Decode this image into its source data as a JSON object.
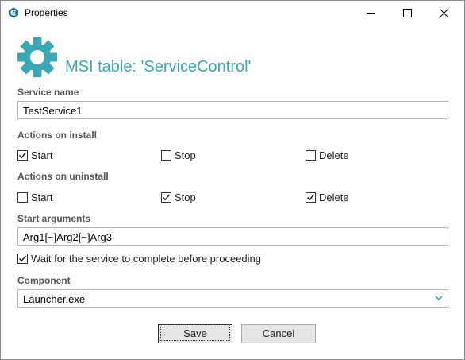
{
  "window": {
    "title": "Properties"
  },
  "header": {
    "heading": "MSI table: 'ServiceControl'"
  },
  "service_name": {
    "label": "Service name",
    "value": "TestService1"
  },
  "actions_on_install": {
    "label": "Actions on install",
    "options": [
      {
        "label": "Start",
        "checked": true
      },
      {
        "label": "Stop",
        "checked": false
      },
      {
        "label": "Delete",
        "checked": false
      }
    ]
  },
  "actions_on_uninstall": {
    "label": "Actions on uninstall",
    "options": [
      {
        "label": "Start",
        "checked": false
      },
      {
        "label": "Stop",
        "checked": true
      },
      {
        "label": "Delete",
        "checked": true
      }
    ]
  },
  "start_arguments": {
    "label": "Start arguments",
    "value": "Arg1[~]Arg2[~]Arg3"
  },
  "wait_option": {
    "label": "Wait for the service to complete before proceeding",
    "checked": true
  },
  "component": {
    "label": "Component",
    "value": "Launcher.exe"
  },
  "buttons": {
    "save": "Save",
    "cancel": "Cancel"
  },
  "colors": {
    "accent": "#3aa7b6",
    "label": "#555555",
    "border": "#b4b4b4"
  }
}
